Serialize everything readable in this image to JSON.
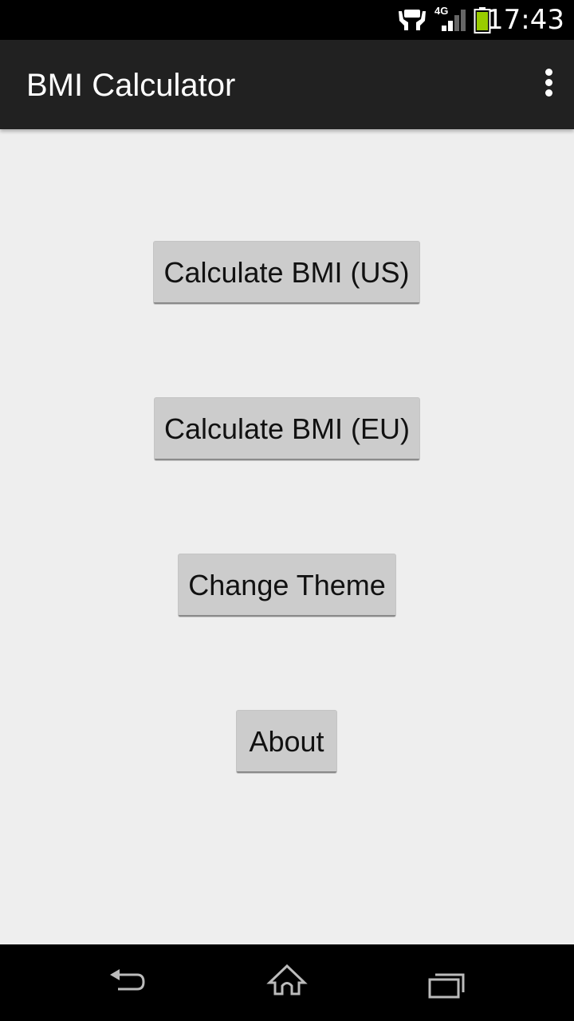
{
  "status_bar": {
    "time": "17:43",
    "network_type": "4G",
    "icons": [
      "hands-notification-icon",
      "signal-icon",
      "battery-icon"
    ]
  },
  "action_bar": {
    "title": "BMI Calculator",
    "overflow_icon": "overflow-menu-icon"
  },
  "main": {
    "buttons": [
      {
        "label": "Calculate BMI (US)"
      },
      {
        "label": "Calculate BMI (EU)"
      },
      {
        "label": "Change Theme"
      },
      {
        "label": "About"
      }
    ]
  },
  "nav_bar": {
    "buttons": [
      "back",
      "home",
      "recent-apps"
    ]
  },
  "colors": {
    "action_bar": "#212121",
    "background": "#eeeeee",
    "button": "#cccccc",
    "battery": "#99cc00"
  }
}
